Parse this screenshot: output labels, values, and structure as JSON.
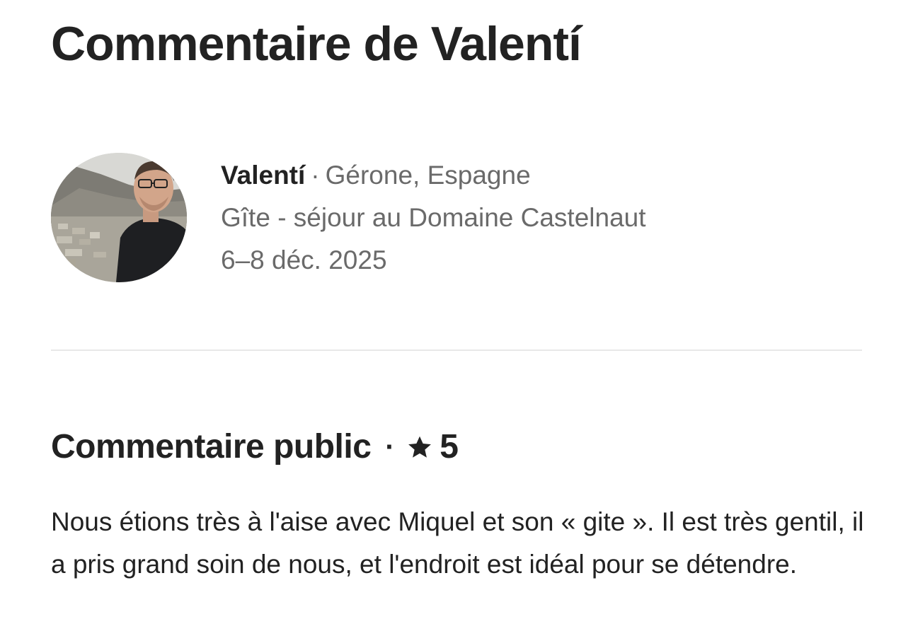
{
  "header": {
    "title": "Commentaire de Valentí"
  },
  "reviewer": {
    "name": "Valentí",
    "separator": "·",
    "location": "Gérone, Espagne",
    "listing": "Gîte - séjour au Domaine Castelnaut",
    "dates": "6–8 déc. 2025",
    "avatar_icon": "avatar-photo"
  },
  "public_review": {
    "title": "Commentaire public",
    "separator": "·",
    "star_icon": "star-icon",
    "rating": "5",
    "text": "Nous étions très à l'aise avec Miquel et son « gite ». Il est très gentil, il a pris grand soin de nous, et l'endroit est idéal pour se détendre."
  },
  "colors": {
    "text_primary": "#222222",
    "text_secondary": "#6a6a6a",
    "divider": "#e8e8e8"
  }
}
